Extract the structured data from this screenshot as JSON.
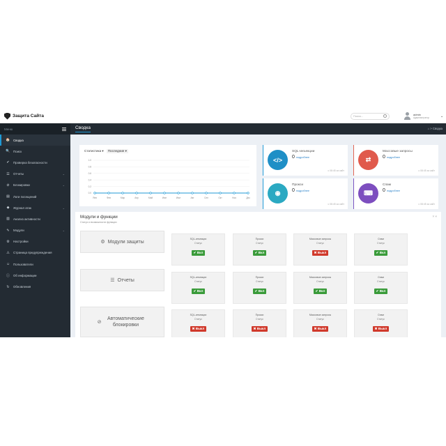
{
  "header": {
    "brand": "Защита Сайта",
    "search_placeholder": "Поиск...",
    "user_name": "admin",
    "user_role": "Администратор"
  },
  "sidebar": {
    "title": "Меню",
    "items": [
      {
        "label": "Сводка",
        "icon": "dashboard-icon",
        "glyph": "🏠"
      },
      {
        "label": "Поиск",
        "icon": "search-icon",
        "glyph": "🔍"
      },
      {
        "label": "Проверка безопасности",
        "icon": "check-icon",
        "glyph": "✔"
      },
      {
        "label": "Отчеты",
        "icon": "list-icon",
        "glyph": "☰"
      },
      {
        "label": "Блокировки",
        "icon": "ban-icon",
        "glyph": "⊘"
      },
      {
        "label": "Логи посещений",
        "icon": "file-icon",
        "glyph": "▤"
      },
      {
        "label": "Журнал атак",
        "icon": "shield-icon",
        "glyph": "◆"
      },
      {
        "label": "Анализ активности",
        "icon": "chart-icon",
        "glyph": "▥"
      },
      {
        "label": "Модули",
        "icon": "wrench-icon",
        "glyph": "✎"
      },
      {
        "label": "Настройки",
        "icon": "gear-icon",
        "glyph": "⚙"
      },
      {
        "label": "Страница предупреждения",
        "icon": "warning-icon",
        "glyph": "⚠"
      },
      {
        "label": "Пользователи",
        "icon": "users-icon",
        "glyph": "☺"
      },
      {
        "label": "Об информации",
        "icon": "info-icon",
        "glyph": "ⓘ"
      },
      {
        "label": "Обновления",
        "icon": "refresh-icon",
        "glyph": "↻"
      }
    ]
  },
  "content": {
    "title": "Сводка",
    "breadcrumb": "⌂ > Сводка"
  },
  "stats": {
    "tab_label": "Статистика ▾",
    "period_label": "Последние ▾"
  },
  "chart_data": {
    "type": "line",
    "x": [
      "Янв",
      "Фев",
      "Мар",
      "Апр",
      "Май",
      "Июн",
      "Июл",
      "Авг",
      "Сен",
      "Окт",
      "Ноя",
      "Дек"
    ],
    "ylim": [
      0,
      1
    ],
    "y_ticks": [
      "1.0",
      "0.8",
      "0.6",
      "0.4",
      "0.2",
      "0.0"
    ],
    "series": [
      {
        "values": [
          0,
          0,
          0,
          0,
          0,
          0,
          0,
          0,
          0,
          0,
          0,
          0
        ],
        "color": "#1f9ad6"
      }
    ]
  },
  "tiles": {
    "sql": {
      "title": "SQL-инъекции",
      "value": "0",
      "link": "подробнее",
      "foot": "с 08:45 за сайт",
      "icon": "code-icon",
      "glyph": "</>"
    },
    "mass": {
      "title": "Массовые запросы",
      "value": "0",
      "link": "подробнее",
      "foot": "с 08:45 за сайт",
      "icon": "retweet-icon",
      "glyph": "⇄"
    },
    "proxy": {
      "title": "Прокси",
      "value": "0",
      "link": "подробнее",
      "foot": "с 08:45 за сайт",
      "icon": "globe-icon",
      "glyph": "◉"
    },
    "spam": {
      "title": "Спам",
      "value": "0",
      "link": "подробнее",
      "foot": "с 08:45 за сайт",
      "icon": "keyboard-icon",
      "glyph": "⌨"
    }
  },
  "modules": {
    "title": "Модули и функции",
    "subtitle": "Статус и возможности функции",
    "controls": "˅ ×",
    "status_label": "Статус",
    "rows": [
      {
        "label": "Модули защиты",
        "icon": "gear-icon",
        "glyph": "⚙",
        "cells": [
          {
            "name": "SQL-инъекции",
            "state": "✔ Вкл",
            "on": true
          },
          {
            "name": "Прокси",
            "state": "✔ Вкл",
            "on": true
          },
          {
            "name": "Массовые запросы",
            "state": "✖ Выкл",
            "on": false
          },
          {
            "name": "Спам",
            "state": "✔ Вкл",
            "on": true
          }
        ]
      },
      {
        "label": "Отчеты",
        "icon": "list-icon",
        "glyph": "☰",
        "cells": [
          {
            "name": "SQL-инъекции",
            "state": "✔ Вкл",
            "on": true
          },
          {
            "name": "Прокси",
            "state": "✔ Вкл",
            "on": true
          },
          {
            "name": "Массовые запросы",
            "state": "✔ Вкл",
            "on": true
          },
          {
            "name": "Спам",
            "state": "✔ Вкл",
            "on": true
          }
        ]
      },
      {
        "label": "Автоматические блокировки",
        "icon": "ban-icon",
        "glyph": "⊘",
        "cells": [
          {
            "name": "SQL-инъекции",
            "state": "✖ Выкл",
            "on": false
          },
          {
            "name": "Прокси",
            "state": "✖ Выкл",
            "on": false
          },
          {
            "name": "Массовые запросы",
            "state": "✖ Выкл",
            "on": false
          },
          {
            "name": "Спам",
            "state": "✖ Выкл",
            "on": false
          }
        ]
      }
    ]
  }
}
